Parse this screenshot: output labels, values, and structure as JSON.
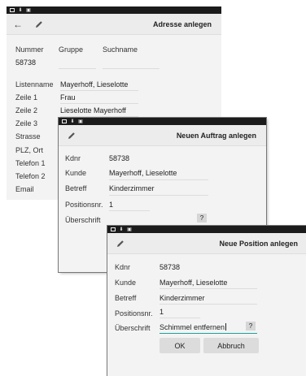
{
  "window1": {
    "title": "Adresse anlegen",
    "headers": {
      "nummer": "Nummer",
      "gruppe": "Gruppe",
      "suchname": "Suchname"
    },
    "nummer_value": "58738",
    "fields": [
      {
        "label": "Listenname",
        "value": "Mayerhoff, Lieselotte"
      },
      {
        "label": "Zeile 1",
        "value": "Frau"
      },
      {
        "label": "Zeile 2",
        "value": "Lieselotte Mayerhoff"
      },
      {
        "label": "Zeile 3",
        "value": ""
      },
      {
        "label": "Strasse",
        "value": ""
      },
      {
        "label": "PLZ, Ort",
        "value": ""
      },
      {
        "label": "Telefon 1",
        "value": ""
      },
      {
        "label": "Telefon 2",
        "value": ""
      },
      {
        "label": "Email",
        "value": ""
      }
    ]
  },
  "window2": {
    "title": "Neuen Auftrag anlegen",
    "fields": [
      {
        "label": "Kdnr",
        "value": "58738"
      },
      {
        "label": "Kunde",
        "value": "Mayerhoff, Lieselotte"
      },
      {
        "label": "Betreff",
        "value": "Kinderzimmer"
      },
      {
        "label": "Positionsnr.",
        "value": "1"
      },
      {
        "label": "Überschrift",
        "value": ""
      }
    ],
    "help_button": "?"
  },
  "window3": {
    "title": "Neue Position anlegen",
    "fields": [
      {
        "label": "Kdnr",
        "value": "58738"
      },
      {
        "label": "Kunde",
        "value": "Mayerhoff, Lieselotte"
      },
      {
        "label": "Betreff",
        "value": "Kinderzimmer"
      },
      {
        "label": "Positionsnr.",
        "value": "1"
      },
      {
        "label": "Überschrift",
        "value": "Schimmel entfernen"
      }
    ],
    "help_button": "?",
    "ok_label": "OK",
    "cancel_label": "Abbruch"
  },
  "colors": {
    "accent": "#1aa39a",
    "statusbar": "#1b1b1b",
    "titlebar": "#ececec",
    "background": "#f3f3f3"
  },
  "icons": {
    "back": "arrow-left-icon",
    "edit": "pencil-icon",
    "status": [
      "image-icon",
      "download-icon",
      "briefcase-icon"
    ]
  }
}
